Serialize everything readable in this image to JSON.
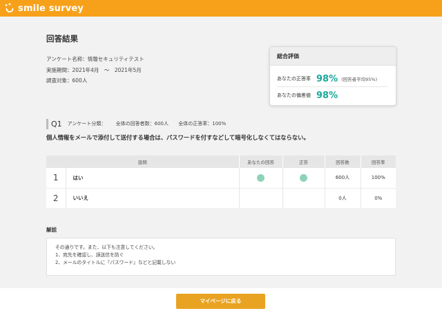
{
  "brand": {
    "name": "smile survey",
    "color": "#f7a11a"
  },
  "page": {
    "title": "回答結果"
  },
  "survey_meta": {
    "name": "アンケート名称：情報セキュリティテスト",
    "period": "実施期間：2021年4月　～　2021年5月",
    "target": "調査対象：600人"
  },
  "summary": {
    "title": "総合評価",
    "accuracy_label": "あなたの正答率",
    "accuracy_value": "98%",
    "accuracy_note": "(回答者平均95%)",
    "deviation_label": "あなたの偏差値",
    "deviation_value": "98%"
  },
  "question": {
    "number": "Q1",
    "category": "アンケート分類：",
    "total_respondents": "全体の回答者数：600人",
    "total_accuracy": "全体の正答率：100%",
    "text": "個人情報をメールで添付して送付する場合は、パスワードを付すなどして暗号化しなくてはならない。"
  },
  "table": {
    "headers": [
      "設問",
      "あなたの回答",
      "正答",
      "回答数",
      "回答率"
    ],
    "rows": [
      {
        "index": "1",
        "label": "はい",
        "your_answer": true,
        "correct": true,
        "count": "600人",
        "rate": "100%"
      },
      {
        "index": "2",
        "label": "いいえ",
        "your_answer": false,
        "correct": false,
        "count": "0人",
        "rate": "0%"
      }
    ],
    "marker_color": "#8dd3b7"
  },
  "explanation": {
    "title": "解説",
    "lines": [
      "その通りです。また、以下も注意してください。",
      "1、宛先を確認し、誤送信を防ぐ",
      "2、メールのタイトルに『パスワード』などと記載しない"
    ]
  },
  "footer": {
    "back_button": "マイページに戻る",
    "button_color": "#e8a322"
  }
}
